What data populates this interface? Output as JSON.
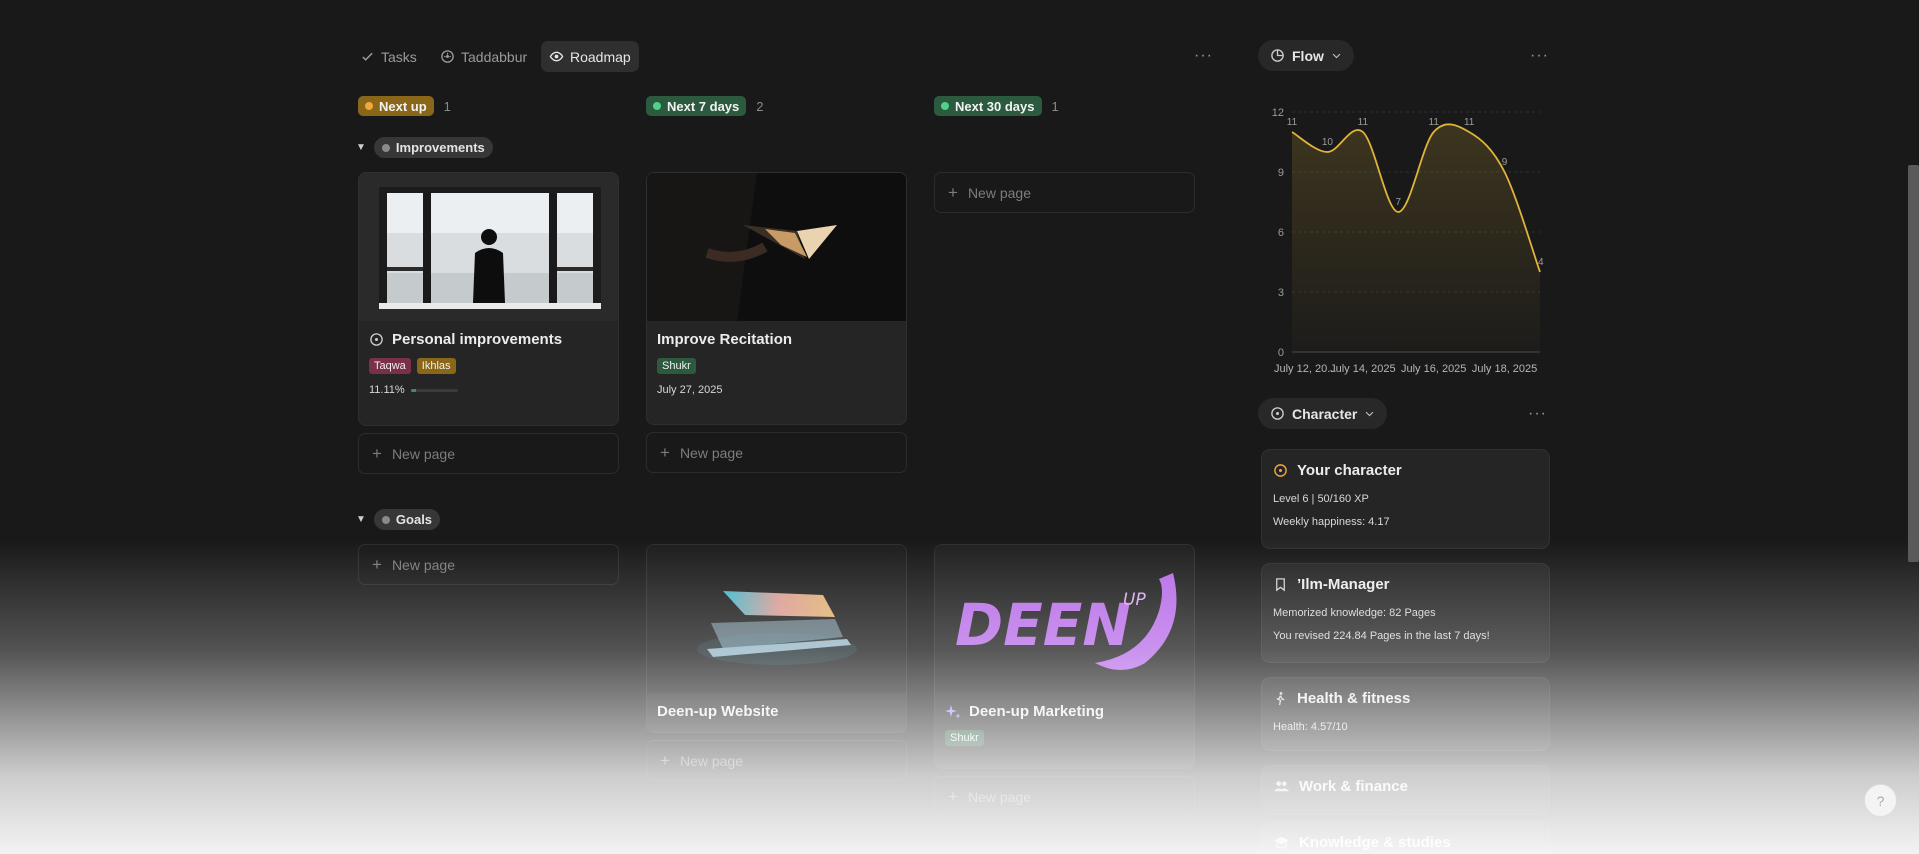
{
  "tabs": [
    {
      "label": "Tasks",
      "icon": "check-icon"
    },
    {
      "label": "Taddabbur",
      "icon": "gauge-icon"
    },
    {
      "label": "Roadmap",
      "icon": "eye-icon"
    }
  ],
  "more_label": "···",
  "columns": [
    {
      "label": "Next up",
      "count": "1",
      "color": "#8a6618",
      "dot": "#f0a83a"
    },
    {
      "label": "Next 7 days",
      "count": "2",
      "color": "#2c5a3f",
      "dot": "#4fd18a"
    },
    {
      "label": "Next 30 days",
      "count": "1",
      "color": "#2c5a3f",
      "dot": "#4fd18a"
    }
  ],
  "groups": {
    "improvements": "Improvements",
    "goals": "Goals"
  },
  "cards": {
    "personal": {
      "title": "Personal improvements",
      "tags": [
        {
          "label": "Taqwa",
          "color": "#7a2f4a"
        },
        {
          "label": "Ikhlas",
          "color": "#8a6618"
        }
      ],
      "progress_text": "11.11%",
      "progress": 0.1111
    },
    "recitation": {
      "title": "Improve Recitation",
      "tags": [
        {
          "label": "Shukr",
          "color": "#2c5a3f"
        }
      ],
      "date": "July 27, 2025"
    },
    "website": {
      "title": "Deen-up Website"
    },
    "marketing": {
      "title": "Deen-up Marketing",
      "tags": [
        {
          "label": "Shukr",
          "color": "#2c5a3f"
        }
      ],
      "logo_text": "DEEN",
      "logo_sup": "UP"
    }
  },
  "new_page_label": "New page",
  "flow": {
    "label": "Flow"
  },
  "chart_data": {
    "type": "area",
    "x": [
      "July 12, 2025",
      "July 13, 2025",
      "July 14, 2025",
      "July 15, 2025",
      "July 16, 2025",
      "July 17, 2025",
      "July 18, 2025",
      "July 19, 2025"
    ],
    "values": [
      11,
      10,
      11,
      7,
      11,
      11,
      9,
      4
    ],
    "x_tick_labels": [
      "July 12, 20...",
      "July 14, 2025",
      "July 16, 2025",
      "July 18, 2025"
    ],
    "y_ticks": [
      "0",
      "3",
      "6",
      "9",
      "12"
    ],
    "ylim": [
      0,
      12
    ],
    "color": "#e0b43a"
  },
  "character": {
    "label": "Character"
  },
  "info_cards": [
    {
      "title": "Your character",
      "lines": [
        "Level 6 | 50/160 XP",
        "Weekly happiness: 4.17"
      ]
    },
    {
      "title": "’Ilm-Manager",
      "lines": [
        "Memorized knowledge: 82 Pages",
        "You revised 224.84 Pages in the last 7 days!"
      ]
    },
    {
      "title": "Health & fitness",
      "lines": [
        "Health: 4.57/10"
      ]
    },
    {
      "title": "Work & finance",
      "lines": []
    },
    {
      "title": "Knowledge & studies",
      "lines": []
    }
  ]
}
